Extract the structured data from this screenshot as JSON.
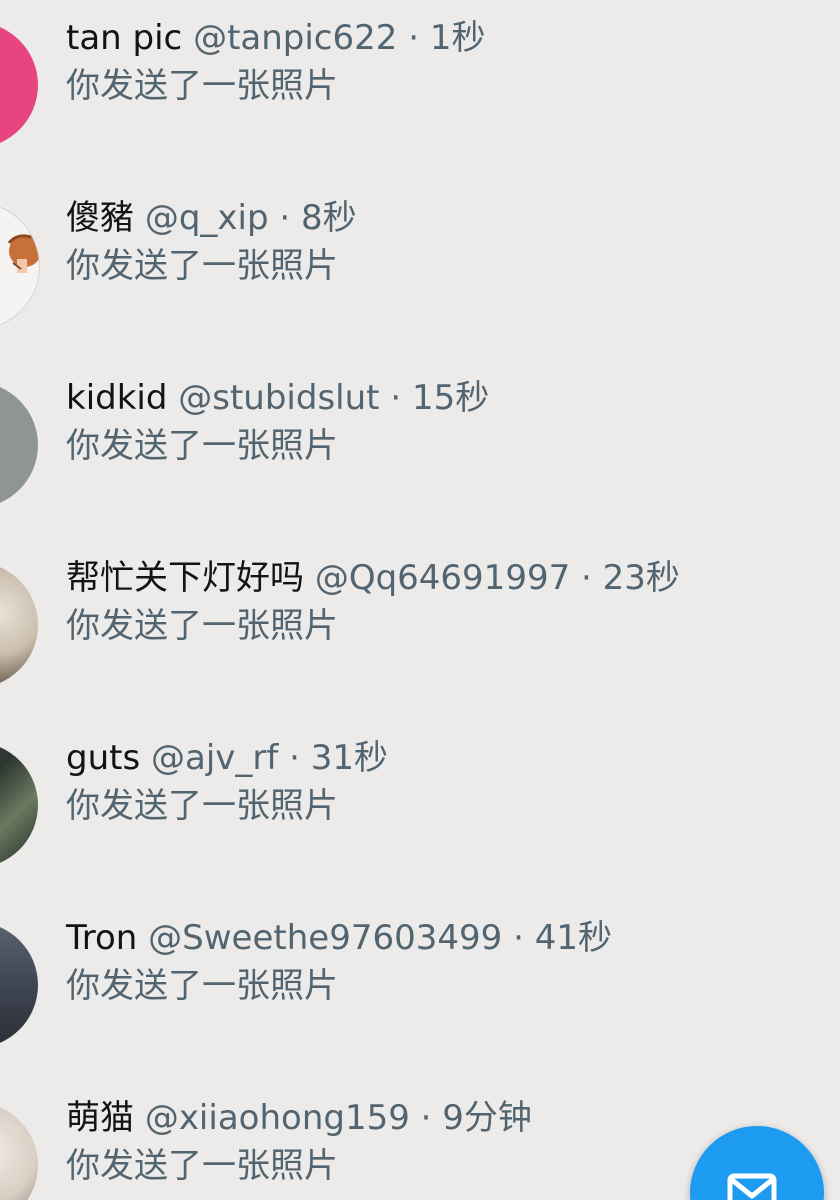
{
  "conversations": [
    {
      "display_name": "tan pic",
      "handle": "@tanpic622",
      "separator": "·",
      "time": "1秒",
      "preview": "你发送了一张照片",
      "avatar_desc": "pink-avatar"
    },
    {
      "display_name": "傻豬",
      "handle": "@q_xip",
      "separator": "·",
      "time": "8秒",
      "preview": "你发送了一张照片",
      "avatar_desc": "cartoon-avatar"
    },
    {
      "display_name": "kidkid",
      "handle": "@stubidslut",
      "separator": "·",
      "time": "15秒",
      "preview": "你发送了一张照片",
      "avatar_desc": "gray-avatar"
    },
    {
      "display_name": "帮忙关下灯好吗",
      "handle": "@Qq64691997",
      "separator": "·",
      "time": "23秒",
      "preview": "你发送了一张照片",
      "avatar_desc": "photo-avatar"
    },
    {
      "display_name": "guts",
      "handle": "@ajv_rf",
      "separator": "·",
      "time": "31秒",
      "preview": "你发送了一张照片",
      "avatar_desc": "dark-photo-avatar"
    },
    {
      "display_name": "Tron",
      "handle": "@Sweethe97603499",
      "separator": "·",
      "time": "41秒",
      "preview": "你发送了一张照片",
      "avatar_desc": "sea-photo-avatar"
    },
    {
      "display_name": "萌猫",
      "handle": "@xiiaohong159",
      "separator": "·",
      "time": "9分钟",
      "preview": "你发送了一张照片",
      "avatar_desc": "light-photo-avatar"
    }
  ],
  "fab": {
    "icon": "new-message-icon"
  },
  "colors": {
    "background": "#edebe9",
    "name_text": "#0f1419",
    "secondary_text": "#536471",
    "accent": "#1d9bf0"
  }
}
